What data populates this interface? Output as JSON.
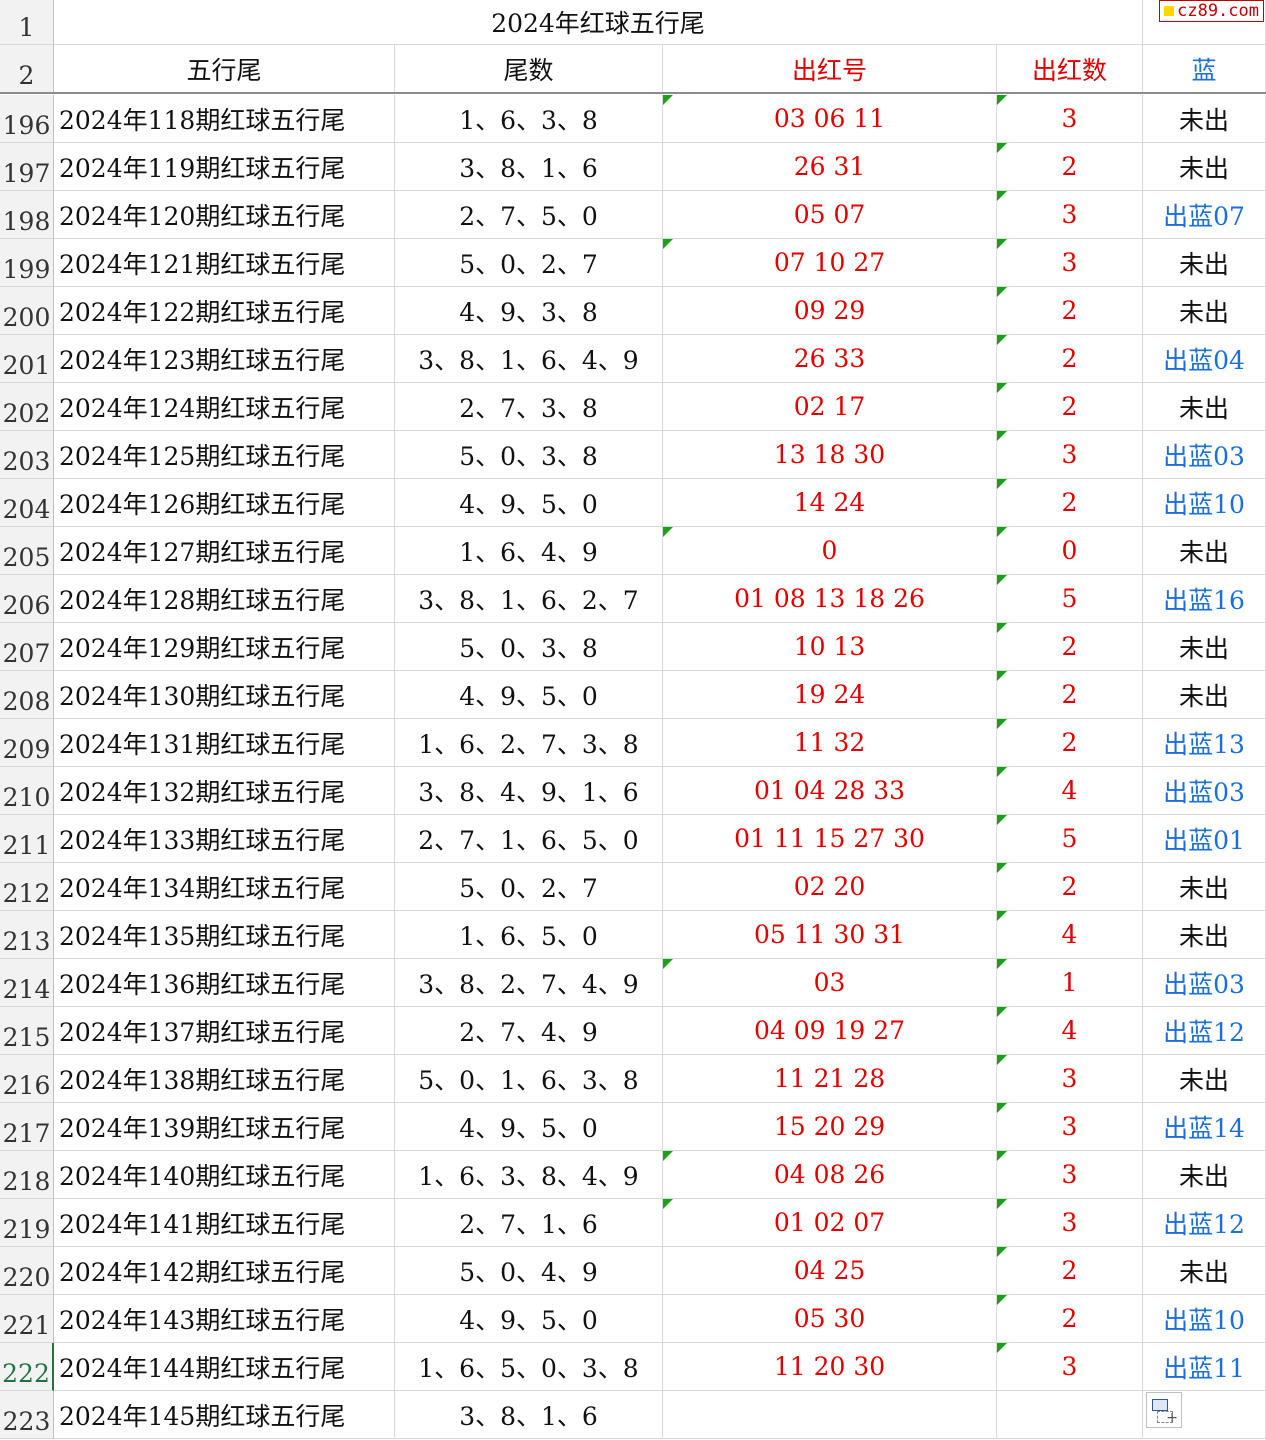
{
  "sheet": {
    "title": "2024年红球五行尾",
    "title_row_number": "1",
    "header_row_number": "2",
    "headers": [
      "五行尾",
      "尾数",
      "出红号",
      "出红数",
      "蓝"
    ],
    "rows": [
      {
        "n": "196",
        "name": "2024年118期红球五行尾",
        "tail": "1、6、3、8",
        "reds": "03  06  11",
        "count": "3",
        "blue": "未出",
        "blue_hit": false,
        "mark3": true
      },
      {
        "n": "197",
        "name": "2024年119期红球五行尾",
        "tail": "3、8、1、6",
        "reds": "26  31",
        "count": "2",
        "blue": "未出",
        "blue_hit": false,
        "mark3": false
      },
      {
        "n": "198",
        "name": "2024年120期红球五行尾",
        "tail": "2、7、5、0",
        "reds": "05  07",
        "count": "3",
        "blue": "出蓝07",
        "blue_hit": true,
        "mark3": false
      },
      {
        "n": "199",
        "name": "2024年121期红球五行尾",
        "tail": "5、0、2、7",
        "reds": "07  10  27",
        "count": "3",
        "blue": "未出",
        "blue_hit": false,
        "mark3": true
      },
      {
        "n": "200",
        "name": "2024年122期红球五行尾",
        "tail": "4、9、3、8",
        "reds": "09  29",
        "count": "2",
        "blue": "未出",
        "blue_hit": false,
        "mark3": false
      },
      {
        "n": "201",
        "name": "2024年123期红球五行尾",
        "tail": "3、8、1、6、4、9",
        "reds": "26  33",
        "count": "2",
        "blue": "出蓝04",
        "blue_hit": true,
        "mark3": false
      },
      {
        "n": "202",
        "name": "2024年124期红球五行尾",
        "tail": "2、7、3、8",
        "reds": "02  17",
        "count": "2",
        "blue": "未出",
        "blue_hit": false,
        "mark3": false
      },
      {
        "n": "203",
        "name": "2024年125期红球五行尾",
        "tail": "5、0、3、8",
        "reds": "13  18  30",
        "count": "3",
        "blue": "出蓝03",
        "blue_hit": true,
        "mark3": false
      },
      {
        "n": "204",
        "name": "2024年126期红球五行尾",
        "tail": "4、9、5、0",
        "reds": "14  24",
        "count": "2",
        "blue": "出蓝10",
        "blue_hit": true,
        "mark3": false
      },
      {
        "n": "205",
        "name": "2024年127期红球五行尾",
        "tail": "1、6、4、9",
        "reds": "0",
        "count": "0",
        "blue": "未出",
        "blue_hit": false,
        "mark3": true
      },
      {
        "n": "206",
        "name": "2024年128期红球五行尾",
        "tail": "3、8、1、6、2、7",
        "reds": "01  08  13  18  26",
        "count": "5",
        "blue": "出蓝16",
        "blue_hit": true,
        "mark3": false
      },
      {
        "n": "207",
        "name": "2024年129期红球五行尾",
        "tail": "5、0、3、8",
        "reds": "10  13",
        "count": "2",
        "blue": "未出",
        "blue_hit": false,
        "mark3": false
      },
      {
        "n": "208",
        "name": "2024年130期红球五行尾",
        "tail": "4、9、5、0",
        "reds": "19  24",
        "count": "2",
        "blue": "未出",
        "blue_hit": false,
        "mark3": false
      },
      {
        "n": "209",
        "name": "2024年131期红球五行尾",
        "tail": "1、6、2、7、3、8",
        "reds": "11  32",
        "count": "2",
        "blue": "出蓝13",
        "blue_hit": true,
        "mark3": false
      },
      {
        "n": "210",
        "name": "2024年132期红球五行尾",
        "tail": "3、8、4、9、1、6",
        "reds": "01  04  28  33",
        "count": "4",
        "blue": "出蓝03",
        "blue_hit": true,
        "mark3": false
      },
      {
        "n": "211",
        "name": "2024年133期红球五行尾",
        "tail": "2、7、1、6、5、0",
        "reds": "01  11  15  27  30",
        "count": "5",
        "blue": "出蓝01",
        "blue_hit": true,
        "mark3": false
      },
      {
        "n": "212",
        "name": "2024年134期红球五行尾",
        "tail": "5、0、2、7",
        "reds": "02  20",
        "count": "2",
        "blue": "未出",
        "blue_hit": false,
        "mark3": false
      },
      {
        "n": "213",
        "name": "2024年135期红球五行尾",
        "tail": "1、6、5、0",
        "reds": "05  11  30  31",
        "count": "4",
        "blue": "未出",
        "blue_hit": false,
        "mark3": false
      },
      {
        "n": "214",
        "name": "2024年136期红球五行尾",
        "tail": "3、8、2、7、4、9",
        "reds": "03",
        "count": "1",
        "blue": "出蓝03",
        "blue_hit": true,
        "mark3": true
      },
      {
        "n": "215",
        "name": "2024年137期红球五行尾",
        "tail": "2、7、4、9",
        "reds": "04  09  19  27",
        "count": "4",
        "blue": "出蓝12",
        "blue_hit": true,
        "mark3": false
      },
      {
        "n": "216",
        "name": "2024年138期红球五行尾",
        "tail": "5、0、1、6、3、8",
        "reds": "11  21  28",
        "count": "3",
        "blue": "未出",
        "blue_hit": false,
        "mark3": false
      },
      {
        "n": "217",
        "name": "2024年139期红球五行尾",
        "tail": "4、9、5、0",
        "reds": "15  20  29",
        "count": "3",
        "blue": "出蓝14",
        "blue_hit": true,
        "mark3": false
      },
      {
        "n": "218",
        "name": "2024年140期红球五行尾",
        "tail": "1、6、3、8、4、9",
        "reds": "04  08  26",
        "count": "3",
        "blue": "未出",
        "blue_hit": false,
        "mark3": true
      },
      {
        "n": "219",
        "name": "2024年141期红球五行尾",
        "tail": "2、7、1、6",
        "reds": "01  02  07",
        "count": "3",
        "blue": "出蓝12",
        "blue_hit": true,
        "mark3": true
      },
      {
        "n": "220",
        "name": "2024年142期红球五行尾",
        "tail": "5、0、4、9",
        "reds": "04  25",
        "count": "2",
        "blue": "未出",
        "blue_hit": false,
        "mark3": false
      },
      {
        "n": "221",
        "name": "2024年143期红球五行尾",
        "tail": "4、9、5、0",
        "reds": "05  30",
        "count": "2",
        "blue": "出蓝10",
        "blue_hit": true,
        "mark3": false
      },
      {
        "n": "222",
        "name": "2024年144期红球五行尾",
        "tail": "1、6、5、0、3、8",
        "reds": "11  20  30",
        "count": "3",
        "blue": "出蓝11",
        "blue_hit": true,
        "mark3": false
      },
      {
        "n": "223",
        "name": "2024年145期红球五行尾",
        "tail": "3、8、1、6",
        "reds": "",
        "count": "",
        "blue": "",
        "blue_hit": false,
        "mark3": false
      }
    ],
    "active_row": "222"
  },
  "watermark": {
    "text": "cz89.com"
  },
  "colors": {
    "red": "#e00000",
    "blue": "#1a6fd8",
    "indicator": "#17a317",
    "active": "#217346"
  },
  "icons": {
    "paste_options": "paste-options-icon"
  }
}
